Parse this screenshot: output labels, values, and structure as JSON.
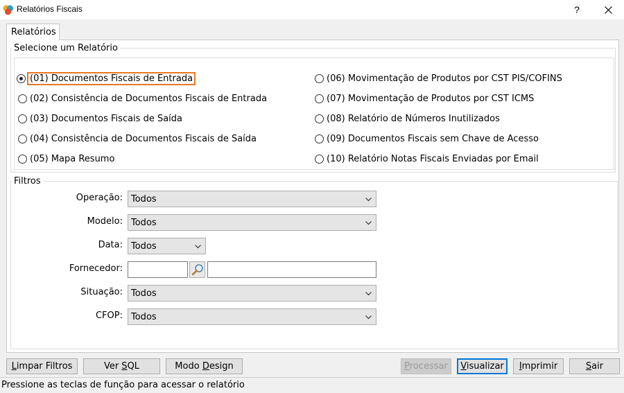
{
  "window": {
    "title": "Relatórios Fiscais",
    "help_label": "?",
    "close_label": "✕"
  },
  "tabs": [
    {
      "label": "Relatórios"
    }
  ],
  "report_group": {
    "legend": "Selecione um Relatório",
    "options": [
      {
        "label": "(01) Documentos Fiscais de Entrada",
        "checked": true
      },
      {
        "label": "(02) Consistência de Documentos Fiscais de Entrada",
        "checked": false
      },
      {
        "label": "(03) Documentos Fiscais de Saída",
        "checked": false
      },
      {
        "label": "(04) Consistência de Documentos Fiscais de Saída",
        "checked": false
      },
      {
        "label": "(05) Mapa Resumo",
        "checked": false
      },
      {
        "label": "(06) Movimentação de Produtos por CST PIS/COFINS",
        "checked": false
      },
      {
        "label": "(07) Movimentação de Produtos por CST ICMS",
        "checked": false
      },
      {
        "label": "(08) Relatório de Números Inutilizados",
        "checked": false
      },
      {
        "label": "(09) Documentos Fiscais sem Chave de Acesso",
        "checked": false
      },
      {
        "label": "(10) Relatório Notas Fiscais Enviadas por Email",
        "checked": false
      }
    ]
  },
  "filters": {
    "legend": "Filtros",
    "operacao": {
      "label": "Operação:",
      "value": "Todos"
    },
    "modelo": {
      "label": "Modelo:",
      "value": "Todos"
    },
    "data": {
      "label": "Data:",
      "value": "Todos"
    },
    "fornecedor": {
      "label": "Fornecedor:",
      "code": "",
      "name": ""
    },
    "situacao": {
      "label": "Situação:",
      "value": "Todos"
    },
    "cfop": {
      "label": "CFOP:",
      "value": "Todos"
    }
  },
  "buttons": {
    "limpar": {
      "pre": "",
      "ul": "L",
      "post": "impar Filtros"
    },
    "ver_sql": {
      "pre": "Ver ",
      "ul": "S",
      "post": "QL"
    },
    "modo_design": {
      "pre": "Modo ",
      "ul": "D",
      "post": "esign"
    },
    "processar": {
      "pre": "",
      "ul": "P",
      "post": "rocessar"
    },
    "visualizar": {
      "pre": "",
      "ul": "V",
      "post": "isualizar"
    },
    "imprimir": {
      "pre": "",
      "ul": "I",
      "post": "mprimir"
    },
    "sair": {
      "pre": "",
      "ul": "S",
      "post": "air"
    }
  },
  "status": {
    "text": "Pressione as teclas de função para acessar o relatório"
  },
  "colors": {
    "focus": "#e87722",
    "default_button": "#0078d7",
    "window_bg": "#f0f0f0"
  }
}
